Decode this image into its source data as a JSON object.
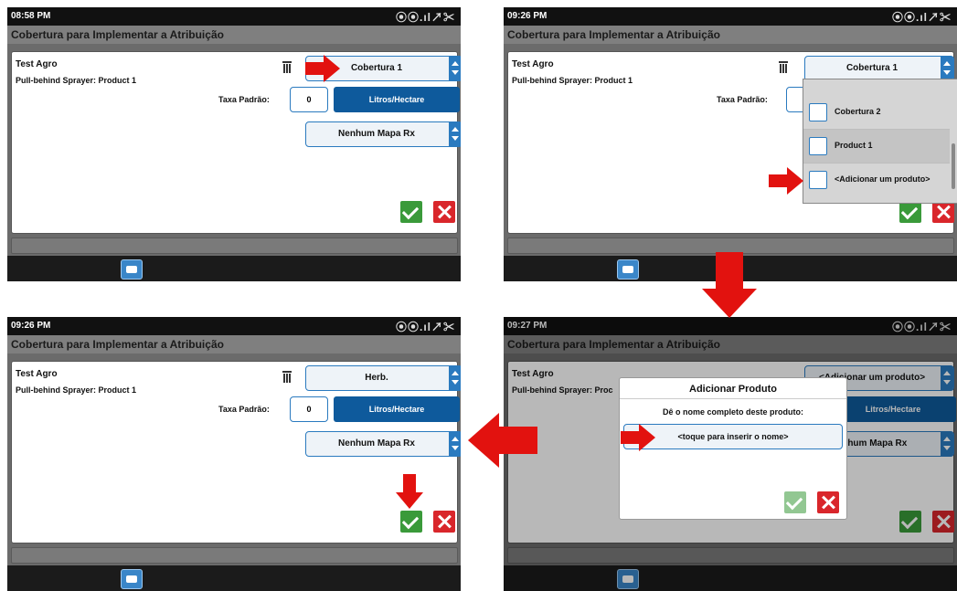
{
  "screens": [
    {
      "time": "08:58 PM",
      "title": "Cobertura para Implementar a Atribuição",
      "name": "Test Agro",
      "machine": "Pull-behind Sprayer: Product 1",
      "product": "Cobertura 1",
      "rate_label": "Taxa Padrão:",
      "rate_value": "0",
      "unit": "Litros/Hectare",
      "rx_map": "Nenhum Mapa Rx"
    },
    {
      "time": "09:26 PM",
      "title": "Cobertura para Implementar a Atribuição",
      "name": "Test Agro",
      "machine": "Pull-behind Sprayer: Product 1",
      "product": "Cobertura 1",
      "rate_label": "Taxa Padrão:",
      "dropdown": [
        "Cobertura 2",
        "Product 1",
        "<Adicionar um produto>"
      ]
    },
    {
      "time": "09:26 PM",
      "title": "Cobertura para Implementar a Atribuição",
      "name": "Test Agro",
      "machine": "Pull-behind Sprayer: Product 1",
      "product": "Herb.",
      "rate_label": "Taxa Padrão:",
      "rate_value": "0",
      "unit": "Litros/Hectare",
      "rx_map": "Nenhum Mapa Rx"
    },
    {
      "time": "09:27 PM",
      "title": "Cobertura para Implementar a Atribuição",
      "name": "Test Agro",
      "machine": "Pull-behind Sprayer: Proc",
      "product": "<Adicionar um produto>",
      "unit": "Litros/Hectare",
      "rx_map": "enhum Mapa Rx",
      "dialog": {
        "title": "Adicionar Produto",
        "prompt": "Dê o nome completo deste produto:",
        "input_placeholder": "<toque para inserir o nome>"
      }
    }
  ],
  "status_icons": "⦿⦿.ıl↗✂",
  "colors": {
    "accent": "#2a7abf",
    "unit_button": "#0e5a9c",
    "ok": "#3a9a3a",
    "cancel": "#d9262b",
    "arrow": "#e2120f"
  }
}
